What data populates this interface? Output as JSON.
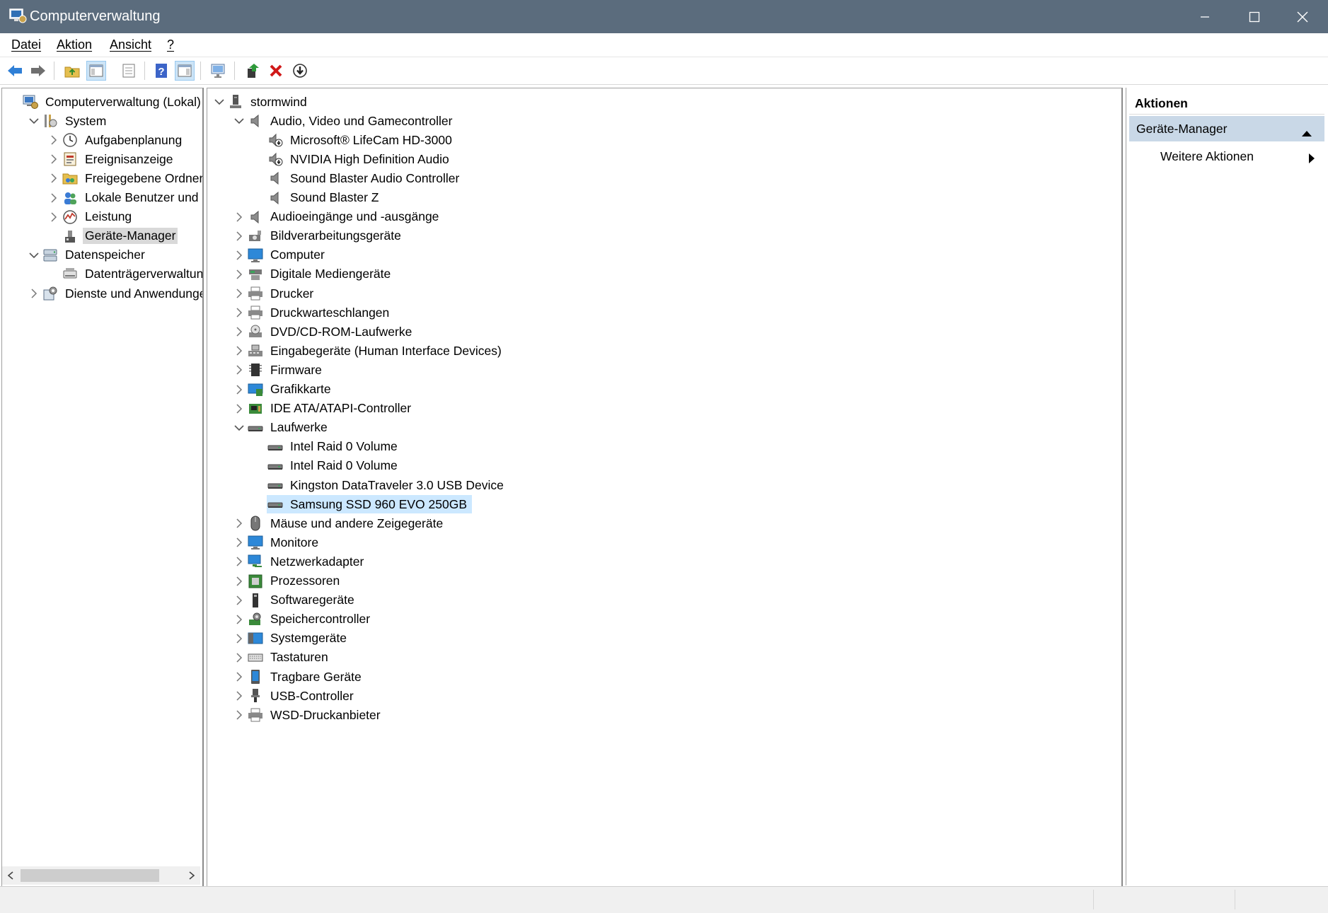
{
  "window": {
    "title": "Computerverwaltung"
  },
  "menu": [
    "Datei",
    "Aktion",
    "Ansicht",
    "?"
  ],
  "toolbar": {
    "buttons": [
      "back-arrow-icon",
      "forward-arrow-icon",
      "up-folder-icon",
      "show-hide-tree-icon",
      "properties-icon",
      "help-icon",
      "show-hide-action-pane-icon",
      "scan-hardware-icon",
      "update-driver-icon",
      "uninstall-icon",
      "disable-device-icon"
    ]
  },
  "left_tree": [
    {
      "label": "Computerverwaltung (Lokal)",
      "indent": 0,
      "chev": "",
      "icon": "computer-management-icon"
    },
    {
      "label": "System",
      "indent": 1,
      "chev": "down",
      "icon": "system-tools-icon"
    },
    {
      "label": "Aufgabenplanung",
      "indent": 2,
      "chev": "right",
      "icon": "clock-icon"
    },
    {
      "label": "Ereignisanzeige",
      "indent": 2,
      "chev": "right",
      "icon": "event-viewer-icon"
    },
    {
      "label": "Freigegebene Ordner",
      "indent": 2,
      "chev": "right",
      "icon": "shared-folder-icon"
    },
    {
      "label": "Lokale Benutzer und Gruppen",
      "indent": 2,
      "chev": "right",
      "icon": "users-icon"
    },
    {
      "label": "Leistung",
      "indent": 2,
      "chev": "right",
      "icon": "performance-icon"
    },
    {
      "label": "Geräte-Manager",
      "indent": 2,
      "chev": "",
      "icon": "device-manager-icon",
      "selected": true
    },
    {
      "label": "Datenspeicher",
      "indent": 1,
      "chev": "down",
      "icon": "storage-icon"
    },
    {
      "label": "Datenträgerverwaltung",
      "indent": 2,
      "chev": "",
      "icon": "disk-management-icon"
    },
    {
      "label": "Dienste und Anwendungen",
      "indent": 1,
      "chev": "right",
      "icon": "services-icon"
    }
  ],
  "device_tree": [
    {
      "label": "stormwind",
      "indent": 0,
      "chev": "down",
      "icon": "computer-icon"
    },
    {
      "label": "Audio, Video und Gamecontroller",
      "indent": 1,
      "chev": "down",
      "icon": "speaker-icon"
    },
    {
      "label": "Microsoft® LifeCam HD-3000",
      "indent": 2,
      "chev": "",
      "icon": "speaker-warning-icon"
    },
    {
      "label": "NVIDIA High Definition Audio",
      "indent": 2,
      "chev": "",
      "icon": "speaker-warning-icon"
    },
    {
      "label": "Sound Blaster Audio Controller",
      "indent": 2,
      "chev": "",
      "icon": "speaker-icon"
    },
    {
      "label": "Sound Blaster Z",
      "indent": 2,
      "chev": "",
      "icon": "speaker-icon"
    },
    {
      "label": "Audioeingänge und -ausgänge",
      "indent": 1,
      "chev": "right",
      "icon": "speaker-icon"
    },
    {
      "label": "Bildverarbeitungsgeräte",
      "indent": 1,
      "chev": "right",
      "icon": "camera-icon"
    },
    {
      "label": "Computer",
      "indent": 1,
      "chev": "right",
      "icon": "monitor-icon"
    },
    {
      "label": "Digitale Mediengeräte",
      "indent": 1,
      "chev": "right",
      "icon": "media-device-icon"
    },
    {
      "label": "Drucker",
      "indent": 1,
      "chev": "right",
      "icon": "printer-icon"
    },
    {
      "label": "Druckwarteschlangen",
      "indent": 1,
      "chev": "right",
      "icon": "printer-icon"
    },
    {
      "label": "DVD/CD-ROM-Laufwerke",
      "indent": 1,
      "chev": "right",
      "icon": "dvd-icon"
    },
    {
      "label": "Eingabegeräte (Human Interface Devices)",
      "indent": 1,
      "chev": "right",
      "icon": "hid-icon"
    },
    {
      "label": "Firmware",
      "indent": 1,
      "chev": "right",
      "icon": "firmware-icon"
    },
    {
      "label": "Grafikkarte",
      "indent": 1,
      "chev": "right",
      "icon": "display-adapter-icon"
    },
    {
      "label": "IDE ATA/ATAPI-Controller",
      "indent": 1,
      "chev": "right",
      "icon": "ide-controller-icon"
    },
    {
      "label": "Laufwerke",
      "indent": 1,
      "chev": "down",
      "icon": "drive-icon"
    },
    {
      "label": "Intel Raid 0 Volume",
      "indent": 2,
      "chev": "",
      "icon": "drive-icon"
    },
    {
      "label": "Intel Raid 0 Volume",
      "indent": 2,
      "chev": "",
      "icon": "drive-icon"
    },
    {
      "label": "Kingston DataTraveler 3.0 USB Device",
      "indent": 2,
      "chev": "",
      "icon": "drive-icon"
    },
    {
      "label": "Samsung SSD 960 EVO 250GB",
      "indent": 2,
      "chev": "",
      "icon": "drive-icon",
      "selected": true
    },
    {
      "label": "Mäuse und andere Zeigegeräte",
      "indent": 1,
      "chev": "right",
      "icon": "mouse-icon"
    },
    {
      "label": "Monitore",
      "indent": 1,
      "chev": "right",
      "icon": "monitor-icon"
    },
    {
      "label": "Netzwerkadapter",
      "indent": 1,
      "chev": "right",
      "icon": "network-adapter-icon"
    },
    {
      "label": "Prozessoren",
      "indent": 1,
      "chev": "right",
      "icon": "processor-icon"
    },
    {
      "label": "Softwaregeräte",
      "indent": 1,
      "chev": "right",
      "icon": "software-device-icon"
    },
    {
      "label": "Speichercontroller",
      "indent": 1,
      "chev": "right",
      "icon": "storage-controller-icon"
    },
    {
      "label": "Systemgeräte",
      "indent": 1,
      "chev": "right",
      "icon": "system-device-icon"
    },
    {
      "label": "Tastaturen",
      "indent": 1,
      "chev": "right",
      "icon": "keyboard-icon"
    },
    {
      "label": "Tragbare Geräte",
      "indent": 1,
      "chev": "right",
      "icon": "portable-device-icon"
    },
    {
      "label": "USB-Controller",
      "indent": 1,
      "chev": "right",
      "icon": "usb-icon"
    },
    {
      "label": "WSD-Druckanbieter",
      "indent": 1,
      "chev": "right",
      "icon": "printer-icon"
    }
  ],
  "actions": {
    "header": "Aktionen",
    "section": "Geräte-Manager",
    "item": "Weitere Aktionen"
  },
  "colors": {
    "titlebar": "#5b6c7d",
    "selection_blue": "#cce8ff",
    "selection_gray": "#d9d9d9",
    "actions_section": "#c9d8e7"
  }
}
